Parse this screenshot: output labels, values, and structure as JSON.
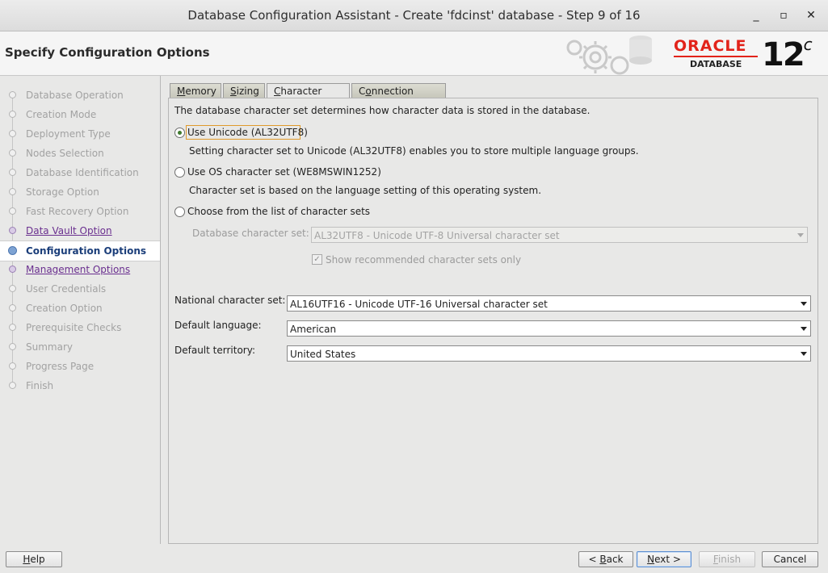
{
  "window": {
    "title": "Database Configuration Assistant - Create 'fdcinst' database - Step 9 of 16",
    "minimize": "_",
    "maximize": "▫",
    "close": "✕"
  },
  "header": {
    "page_title": "Specify Configuration Options",
    "brand": "ORACLE",
    "brand_sub": "DATABASE",
    "version": "12",
    "version_suffix": "c"
  },
  "nav": {
    "items": [
      {
        "label": "Database Operation",
        "state": "done"
      },
      {
        "label": "Creation Mode",
        "state": "done"
      },
      {
        "label": "Deployment Type",
        "state": "done"
      },
      {
        "label": "Nodes Selection",
        "state": "done"
      },
      {
        "label": "Database Identification",
        "state": "done"
      },
      {
        "label": "Storage Option",
        "state": "done"
      },
      {
        "label": "Fast Recovery Option",
        "state": "done"
      },
      {
        "label": "Data Vault Option",
        "state": "link"
      },
      {
        "label": "Configuration Options",
        "state": "current"
      },
      {
        "label": "Management Options",
        "state": "link"
      },
      {
        "label": "User Credentials",
        "state": "pending"
      },
      {
        "label": "Creation Option",
        "state": "pending"
      },
      {
        "label": "Prerequisite Checks",
        "state": "pending"
      },
      {
        "label": "Summary",
        "state": "pending"
      },
      {
        "label": "Progress Page",
        "state": "pending"
      },
      {
        "label": "Finish",
        "state": "pending"
      }
    ]
  },
  "tabs": [
    {
      "label": "Memory",
      "mnemonic": "M"
    },
    {
      "label": "Sizing",
      "mnemonic": "S"
    },
    {
      "label": "Character sets",
      "mnemonic": "C"
    },
    {
      "label": "Connection mode",
      "mnemonic": "o"
    }
  ],
  "active_tab": "Character sets",
  "charset": {
    "intro": "The database character set determines how character data is stored in the database.",
    "opt_unicode": "Use Unicode (AL32UTF8)",
    "opt_unicode_desc": "Setting character set to Unicode (AL32UTF8) enables you to store multiple language groups.",
    "opt_os": "Use OS character set (WE8MSWIN1252)",
    "opt_os_desc": "Character set is based on the language setting of this operating system.",
    "opt_list": "Choose from the list of character sets",
    "selected_option": "unicode",
    "db_charset_label": "Database character set:",
    "db_charset_value": "AL32UTF8 - Unicode UTF-8 Universal character set",
    "show_recommended_label": "Show recommended character sets only",
    "show_recommended_checked": true,
    "national_label": "National character set:",
    "national_value": "AL16UTF16 - Unicode UTF-16 Universal character set",
    "language_label": "Default language:",
    "language_value": "American",
    "territory_label": "Default territory:",
    "territory_value": "United States"
  },
  "footer": {
    "help": "Help",
    "back": "< Back",
    "next": "Next >",
    "finish": "Finish",
    "cancel": "Cancel"
  },
  "colors": {
    "oracle_red": "#e2231a",
    "current_step": "#1b3e7a",
    "link_step": "#6a2f8f"
  }
}
